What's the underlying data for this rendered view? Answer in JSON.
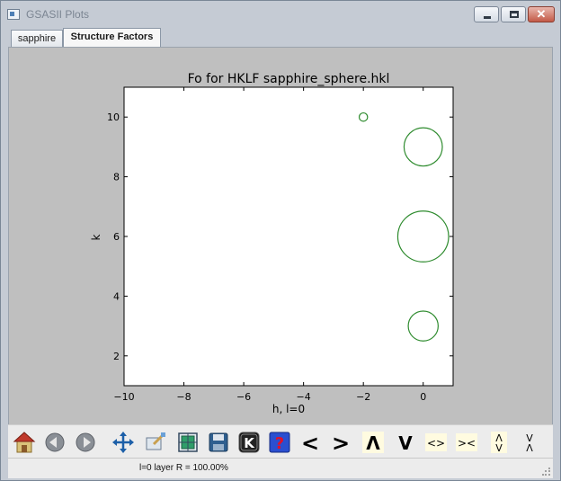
{
  "window": {
    "title": "GSASII Plots"
  },
  "tabs": [
    {
      "label": "sapphire",
      "active": false
    },
    {
      "label": "Structure Factors",
      "active": true
    }
  ],
  "chart_data": {
    "type": "scatter",
    "title": "Fo for HKLF sapphire_sphere.hkl",
    "xlabel": "h, l=0",
    "ylabel": "k",
    "xlim": [
      -10,
      1
    ],
    "ylim": [
      1,
      11
    ],
    "x_ticks": [
      -10,
      -8,
      -6,
      -4,
      -2,
      0
    ],
    "y_ticks": [
      2,
      4,
      6,
      8,
      10
    ],
    "marker": "open-circle",
    "color": "#2e8b2e",
    "points": [
      {
        "h": -2,
        "k": 10,
        "fo": 0.14
      },
      {
        "h": 0,
        "k": 9,
        "fo": 0.64
      },
      {
        "h": 0,
        "k": 6,
        "fo": 0.85
      },
      {
        "h": 0,
        "k": 3,
        "fo": 0.5
      }
    ]
  },
  "toolbar": {
    "icons": [
      "home-icon",
      "back-icon",
      "forward-icon",
      "pan-icon",
      "zoom-icon",
      "subplots-icon",
      "save-icon",
      "key-icon",
      "help-icon"
    ],
    "arrow_buttons": [
      "<",
      ">",
      "Λ",
      "V",
      "<>",
      "><",
      "Λ\nV",
      "V\nΛ"
    ]
  },
  "status": {
    "text": "l=0 layer R = 100.00%"
  }
}
